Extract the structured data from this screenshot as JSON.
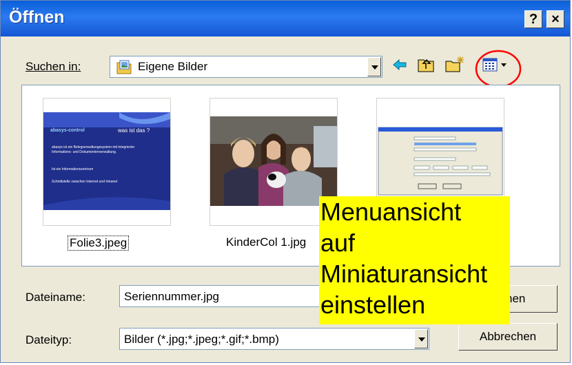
{
  "window": {
    "title": "Öffnen",
    "help_label": "?",
    "close_label": "×"
  },
  "lookin": {
    "label": "Suchen in:",
    "value": "Eigene Bilder"
  },
  "toolbar": {
    "icons": [
      "back-arrow-icon",
      "up-folder-icon",
      "new-folder-icon",
      "view-menu-icon"
    ]
  },
  "files": [
    {
      "name": "Folie3.jpeg"
    },
    {
      "name": "KinderCol 1.jpg"
    },
    {
      "name": ""
    }
  ],
  "slide": {
    "brand": "abasys-control",
    "heading": "was ist das ?",
    "bullets": [
      "abasys ist ein Belegverwaltungssystem mit integrierter Informations- und Dokumentenverwaltung.",
      "Ist ein Informationszentrum",
      "Schnittstelle zwischen Internet und Intranet"
    ]
  },
  "filename": {
    "label": "Dateiname:",
    "value": "Seriennummer.jpg"
  },
  "filetype": {
    "label": "Dateityp:",
    "value": "Bilder (*.jpg;*.jpeg;*.gif;*.bmp)"
  },
  "buttons": {
    "open_label": "Öffnen",
    "cancel_label": "Abbrechen"
  },
  "annotation": {
    "lines": [
      "Menuansicht",
      "auf",
      "Miniaturansicht",
      "einstellen"
    ],
    "highlight_color": "#ff0000",
    "background": "#ffff00"
  }
}
